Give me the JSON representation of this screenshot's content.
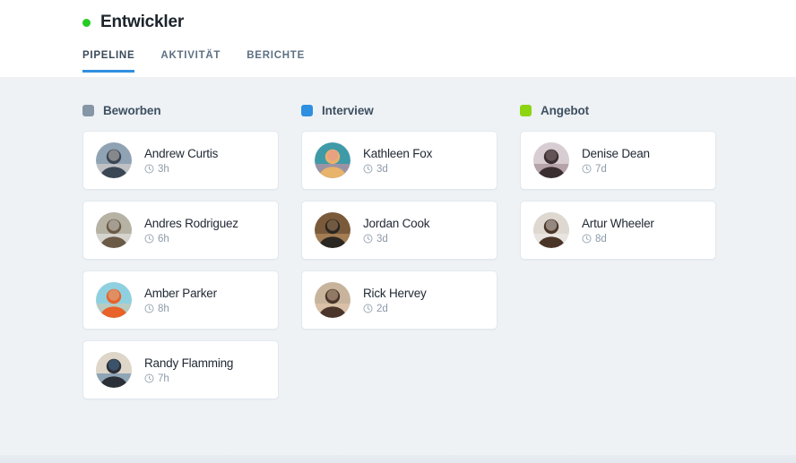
{
  "header": {
    "status_dot_color": "#24cc24",
    "title": "Entwickler",
    "tabs": [
      {
        "label": "PIPELINE",
        "active": true
      },
      {
        "label": "AKTIVITÄT",
        "active": false
      },
      {
        "label": "BERICHTE",
        "active": false
      }
    ]
  },
  "board": {
    "columns": [
      {
        "title": "Beworben",
        "swatch_color": "#8596a6",
        "cards": [
          {
            "name": "Andrew Curtis",
            "time": "3h",
            "time_icon": "clock-icon",
            "avatar": "avatar-andrew-curtis",
            "avatar_colors": [
              "#8fa3b4",
              "#3a4654",
              "#e7d9cf"
            ]
          },
          {
            "name": "Andres Rodriguez",
            "time": "6h",
            "time_icon": "clock-icon",
            "avatar": "avatar-andres-rodriguez",
            "avatar_colors": [
              "#b6b2a4",
              "#6b5a46",
              "#efefef"
            ]
          },
          {
            "name": "Amber Parker",
            "time": "8h",
            "time_icon": "clock-icon",
            "avatar": "avatar-amber-parker",
            "avatar_colors": [
              "#8fd0e0",
              "#e8622a",
              "#d8c7a8"
            ]
          },
          {
            "name": "Randy Flamming",
            "time": "7h",
            "time_icon": "clock-icon",
            "avatar": "avatar-randy-flamming",
            "avatar_colors": [
              "#ded6c8",
              "#2b2f38",
              "#4f7ea8"
            ]
          }
        ]
      },
      {
        "title": "Interview",
        "swatch_color": "#2f8fe0",
        "cards": [
          {
            "name": "Kathleen Fox",
            "time": "3d",
            "time_icon": "clock-icon",
            "avatar": "avatar-kathleen-fox",
            "avatar_colors": [
              "#3f9aa8",
              "#e8b36a",
              "#e88ea0"
            ]
          },
          {
            "name": "Jordan Cook",
            "time": "3d",
            "time_icon": "clock-icon",
            "avatar": "avatar-jordan-cook",
            "avatar_colors": [
              "#7a5a3a",
              "#2a2622",
              "#c79a6a"
            ]
          },
          {
            "name": "Rick Hervey",
            "time": "2d",
            "time_icon": "clock-icon",
            "avatar": "avatar-rick-hervey",
            "avatar_colors": [
              "#c8b49c",
              "#4a352a",
              "#e8cbb0"
            ]
          }
        ]
      },
      {
        "title": "Angebot",
        "swatch_color": "#8dd411",
        "cards": [
          {
            "name": "Denise Dean",
            "time": "7d",
            "time_icon": "clock-icon",
            "avatar": "avatar-denise-dean",
            "avatar_colors": [
              "#d8cdd2",
              "#3a2e30",
              "#9a8086"
            ]
          },
          {
            "name": "Artur Wheeler",
            "time": "8d",
            "time_icon": "clock-icon",
            "avatar": "avatar-artur-wheeler",
            "avatar_colors": [
              "#ded8d0",
              "#4a3428",
              "#f0f0ee"
            ]
          }
        ]
      }
    ]
  }
}
